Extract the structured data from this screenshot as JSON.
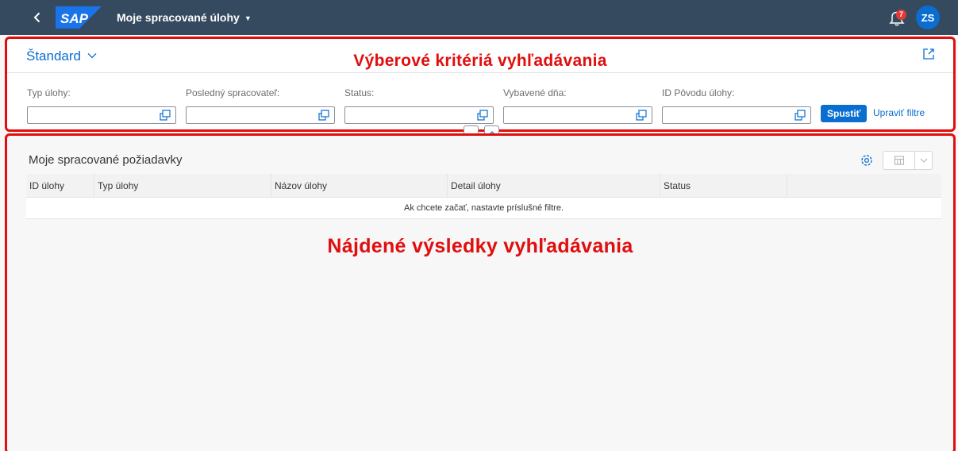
{
  "shell": {
    "title": "Moje spracované úlohy",
    "logo_text": "SAP",
    "notification_count": "7",
    "avatar_initials": "ZS",
    "header_color": "#354a5f",
    "accent_color": "#0a6ed1"
  },
  "filter": {
    "variant": "Štandard",
    "annotation": "Výberové kritériá vyhľadávania",
    "fields": [
      {
        "label": "Typ úlohy:",
        "value": ""
      },
      {
        "label": "Posledný spracovateľ:",
        "value": ""
      },
      {
        "label": "Status:",
        "value": ""
      },
      {
        "label": "Vybavené dňa:",
        "value": ""
      },
      {
        "label": "ID Pôvodu úlohy:",
        "value": ""
      }
    ],
    "go_label": "Spustiť",
    "adapt_label": "Upraviť filtre"
  },
  "results": {
    "title": "Moje spracované požiadavky",
    "columns": [
      "ID úlohy",
      "Typ úlohy",
      "Názov úlohy",
      "Detail úlohy",
      "Status"
    ],
    "empty_text": "Ak chcete začať, nastavte príslušné filtre.",
    "annotation": "Nájdené výsledky vyhľadávania",
    "annotation_color": "#e10e0e"
  }
}
